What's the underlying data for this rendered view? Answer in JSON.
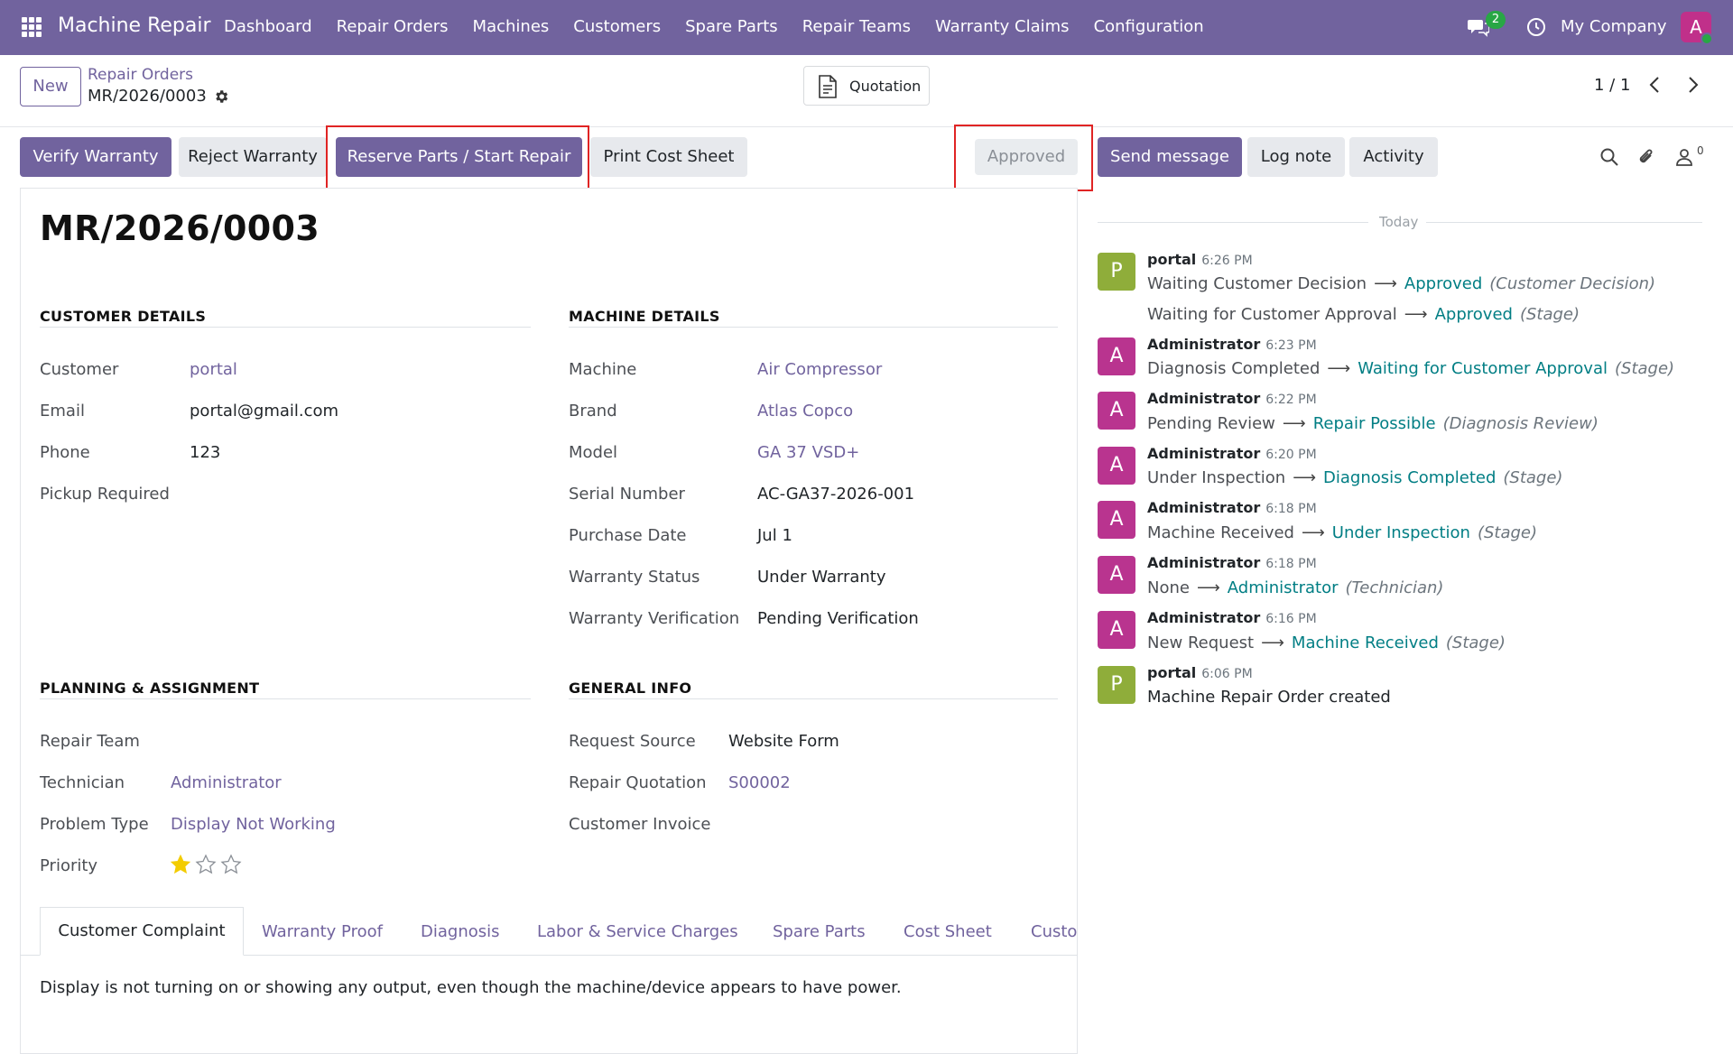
{
  "topbar": {
    "app_name": "Machine Repair",
    "menu": [
      "Dashboard",
      "Repair Orders",
      "Machines",
      "Customers",
      "Spare Parts",
      "Repair Teams",
      "Warranty Claims",
      "Configuration"
    ],
    "chat_count": "2",
    "company": "My Company",
    "user_initial": "A"
  },
  "control": {
    "new_label": "New",
    "breadcrumb_parent": "Repair Orders",
    "breadcrumb_current": "MR/2026/0003",
    "quotation_label": "Quotation",
    "pager": "1 / 1"
  },
  "actions": {
    "verify": "Verify Warranty",
    "reject": "Reject Warranty",
    "reserve": "Reserve Parts / Start Repair",
    "print": "Print Cost Sheet",
    "status": "Approved"
  },
  "chatter_buttons": {
    "send": "Send message",
    "log": "Log note",
    "activity": "Activity",
    "followers": "0"
  },
  "record": {
    "title": "MR/2026/0003",
    "customer_section": "CUSTOMER DETAILS",
    "customer_fields": [
      {
        "label": "Customer",
        "value": "portal"
      },
      {
        "label": "Email",
        "value": "portal@gmail.com"
      },
      {
        "label": "Phone",
        "value": "123"
      },
      {
        "label": "Pickup Required",
        "value": ""
      }
    ],
    "machine_section": "MACHINE DETAILS",
    "machine_fields": [
      {
        "label": "Machine",
        "value": "Air Compressor"
      },
      {
        "label": "Brand",
        "value": "Atlas Copco"
      },
      {
        "label": "Model",
        "value": "GA 37 VSD+"
      },
      {
        "label": "Serial Number",
        "value": "AC-GA37-2026-001"
      },
      {
        "label": "Purchase Date",
        "value": "Jul 1"
      },
      {
        "label": "Warranty Status",
        "value": "Under Warranty"
      },
      {
        "label": "Warranty Verification",
        "value": "Pending Verification"
      }
    ],
    "planning_section": "PLANNING & ASSIGNMENT",
    "planning_fields": [
      {
        "label": "Repair Team",
        "value": ""
      },
      {
        "label": "Technician",
        "value": "Administrator"
      },
      {
        "label": "Problem Type",
        "value": "Display Not Working"
      },
      {
        "label": "Priority",
        "value": ""
      }
    ],
    "priority_stars": 1,
    "general_section": "GENERAL INFO",
    "general_fields": [
      {
        "label": "Request Source",
        "value": "Website Form"
      },
      {
        "label": "Repair Quotation",
        "value": "S00002"
      },
      {
        "label": "Customer Invoice",
        "value": ""
      }
    ]
  },
  "tabs": [
    "Customer Complaint",
    "Warranty Proof",
    "Diagnosis",
    "Labor & Service Charges",
    "Spare Parts",
    "Cost Sheet",
    "Custo"
  ],
  "tab_content": "Display is not turning on or showing any output, even though the machine/device appears to have power.",
  "chatter": {
    "today": "Today",
    "messages": [
      {
        "initial": "P",
        "author": "portal",
        "time": "6:26 PM",
        "lines": [
          {
            "old": "Waiting Customer Decision",
            "new": "Approved",
            "field": "(Customer Decision)"
          },
          {
            "old": "Waiting for Customer Approval",
            "new": "Approved",
            "field": "(Stage)"
          }
        ]
      },
      {
        "initial": "A",
        "author": "Administrator",
        "time": "6:23 PM",
        "lines": [
          {
            "old": "Diagnosis Completed",
            "new": "Waiting for Customer Approval",
            "field": "(Stage)"
          }
        ]
      },
      {
        "initial": "A",
        "author": "Administrator",
        "time": "6:22 PM",
        "lines": [
          {
            "old": "Pending Review",
            "new": "Repair Possible",
            "field": "(Diagnosis Review)"
          }
        ]
      },
      {
        "initial": "A",
        "author": "Administrator",
        "time": "6:20 PM",
        "lines": [
          {
            "old": "Under Inspection",
            "new": "Diagnosis Completed",
            "field": "(Stage)"
          }
        ]
      },
      {
        "initial": "A",
        "author": "Administrator",
        "time": "6:18 PM",
        "lines": [
          {
            "old": "Machine Received",
            "new": "Under Inspection",
            "field": "(Stage)"
          }
        ]
      },
      {
        "initial": "A",
        "author": "Administrator",
        "time": "6:18 PM",
        "lines": [
          {
            "old": "None",
            "new": "Administrator",
            "field": "(Technician)"
          }
        ]
      },
      {
        "initial": "A",
        "author": "Administrator",
        "time": "6:16 PM",
        "lines": [
          {
            "old": "New Request",
            "new": "Machine Received",
            "field": "(Stage)"
          }
        ]
      },
      {
        "initial": "P",
        "author": "portal",
        "time": "6:06 PM",
        "body": "Machine Repair Order created"
      }
    ]
  },
  "colors": {
    "brand": "#71639e",
    "link_new": "#017e84",
    "highlight": "#e02424"
  }
}
